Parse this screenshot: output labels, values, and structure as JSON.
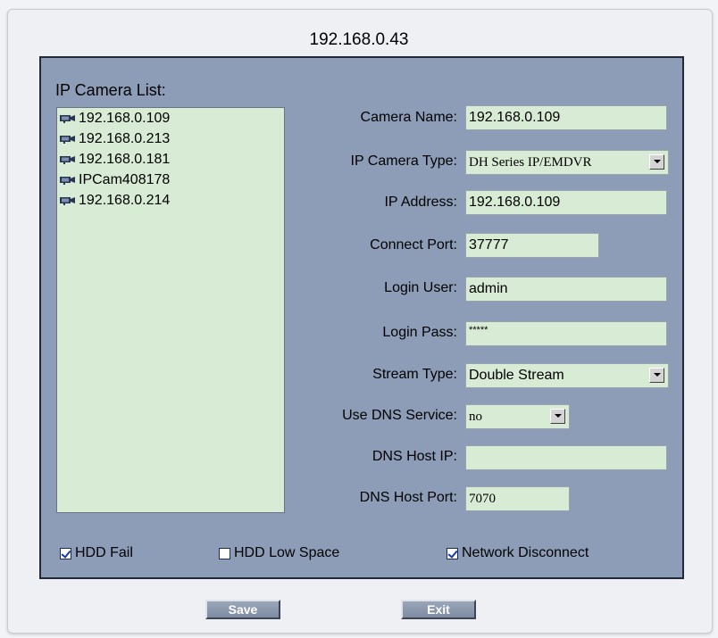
{
  "window": {
    "title": "192.168.0.43"
  },
  "camera_list": {
    "title": "IP Camera List:",
    "items": [
      "192.168.0.109",
      "192.168.0.213",
      "192.168.0.181",
      "IPCam408178",
      "192.168.0.214"
    ],
    "item_icon": "camera-icon"
  },
  "form": {
    "camera_name": {
      "label": "Camera Name:",
      "value": "192.168.0.109"
    },
    "camera_type": {
      "label": "IP Camera Type:",
      "value": "DH Series IP/EMDVR"
    },
    "ip_address": {
      "label": "IP Address:",
      "value": "192.168.0.109"
    },
    "connect_port": {
      "label": "Connect Port:",
      "value": "37777"
    },
    "login_user": {
      "label": "Login User:",
      "value": "admin"
    },
    "login_pass": {
      "label": "Login Pass:",
      "value": "*****"
    },
    "stream_type": {
      "label": "Stream Type:",
      "value": "Double Stream"
    },
    "use_dns": {
      "label": "Use DNS Service:",
      "value": "no"
    },
    "dns_host_ip": {
      "label": "DNS Host IP:",
      "value": ""
    },
    "dns_host_port": {
      "label": "DNS Host Port:",
      "value": "7070"
    }
  },
  "alarms": {
    "hdd_fail": {
      "label": "HDD Fail",
      "checked": true
    },
    "hdd_low_space": {
      "label": "HDD Low Space",
      "checked": false
    },
    "network_disconnect": {
      "label": "Network Disconnect",
      "checked": true
    }
  },
  "buttons": {
    "save": "Save",
    "exit": "Exit"
  },
  "colors": {
    "panel": "#8d9db8",
    "field": "#d8ebd4",
    "check": "#1438b8"
  }
}
